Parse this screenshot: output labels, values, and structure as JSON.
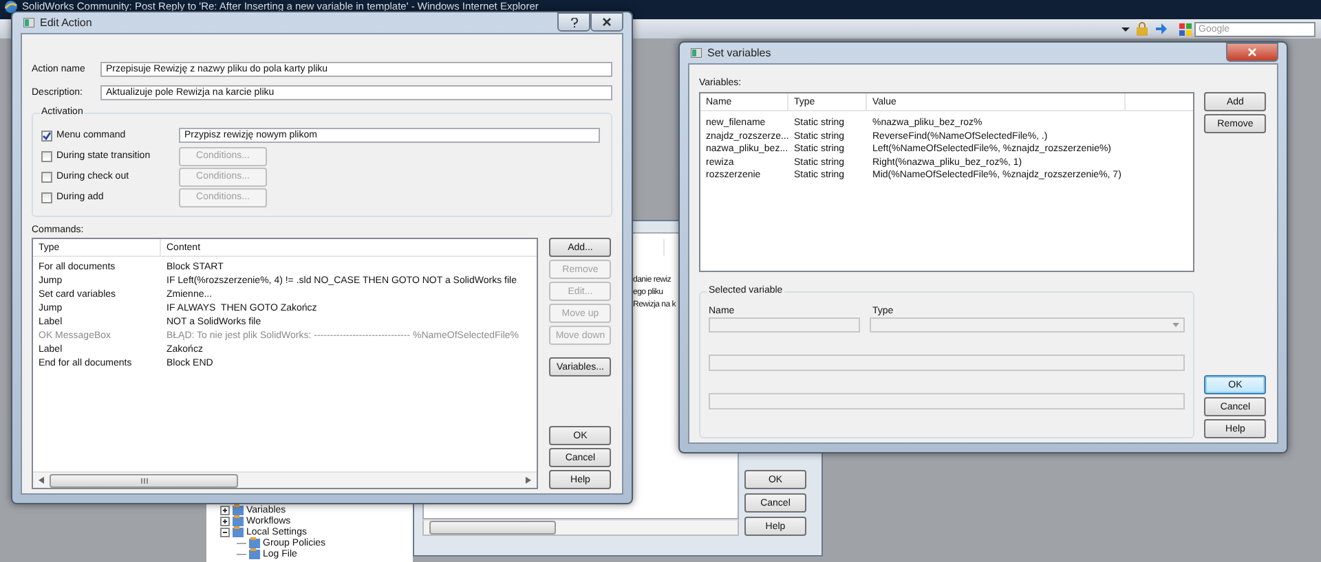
{
  "browser": {
    "title": "SolidWorks Community: Post Reply to 'Re: After Inserting a new variable in template' - Windows Internet Explorer",
    "search_placeholder": "Google"
  },
  "background_window": {
    "texts": [
      "danie rewiz",
      "ego pliku",
      "Rewizja na k"
    ],
    "buttons": [
      "OK",
      "Cancel",
      "Help"
    ]
  },
  "tree": [
    {
      "label": "Variables",
      "expanded": false
    },
    {
      "label": "Workflows",
      "expanded": false
    },
    {
      "label": "Local Settings",
      "expanded": true,
      "children": [
        {
          "label": "Group Policies"
        },
        {
          "label": "Log File"
        }
      ]
    }
  ],
  "edit_action": {
    "title": "Edit Action",
    "fields": [
      {
        "label": "Action name",
        "value": "Przepisuje Rewizję z nazwy pliku do pola karty pliku"
      },
      {
        "label": "Description:",
        "value": "Aktualizuje pole Rewizja na karcie pliku"
      }
    ],
    "activation": {
      "title": "Activation",
      "rows": [
        {
          "kind": "field",
          "label": "Menu command",
          "checked": true,
          "value": "Przypisz rewizję nowym plikom"
        },
        {
          "kind": "button",
          "label": "During state transition",
          "checked": false,
          "button": "Conditions...",
          "disabled": true
        },
        {
          "kind": "button",
          "label": "During check out",
          "checked": false,
          "button": "Conditions...",
          "disabled": true
        },
        {
          "kind": "button",
          "label": "During add",
          "checked": false,
          "button": "Conditions...",
          "disabled": true
        }
      ]
    },
    "commands": {
      "label": "Commands:",
      "columns": [
        "Type",
        "Content"
      ],
      "rows": [
        {
          "type": "For all documents",
          "content": "Block START",
          "disabled": false
        },
        {
          "type": "Jump",
          "content": "IF Left(%rozszerzenie%, 4) != .sld NO_CASE THEN GOTO NOT a SolidWorks file",
          "disabled": false
        },
        {
          "type": "Set card variables",
          "content": "Zmienne...",
          "disabled": false
        },
        {
          "type": "Jump",
          "content": "IF ALWAYS  THEN GOTO Zakończ",
          "disabled": false
        },
        {
          "type": "Label",
          "content": "NOT a SolidWorks file",
          "disabled": false
        },
        {
          "type": "OK MessageBox",
          "content": "BŁĄD: To nie jest plik SolidWorks: ------------------------------ %NameOfSelectedFile%",
          "disabled": true
        },
        {
          "type": "Label",
          "content": "Zakończ",
          "disabled": false
        },
        {
          "type": "End for all documents",
          "content": "Block END",
          "disabled": false
        }
      ]
    },
    "side_buttons": [
      {
        "label": "Add...",
        "disabled": false
      },
      {
        "label": "Remove",
        "disabled": true
      },
      {
        "label": "Edit...",
        "disabled": true
      },
      {
        "label": "Move up",
        "disabled": true
      },
      {
        "label": "Move down",
        "disabled": true
      }
    ],
    "variables_button": "Variables...",
    "footer_buttons": [
      "OK",
      "Cancel",
      "Help"
    ]
  },
  "set_variables": {
    "title": "Set variables",
    "label": "Variables:",
    "columns": [
      "Name",
      "Type",
      "Value"
    ],
    "rows": [
      {
        "name": "new_filename",
        "type": "Static string",
        "value": "%nazwa_pliku_bez_roz%"
      },
      {
        "name": "znajdz_rozszerze...",
        "type": "Static string",
        "value": "ReverseFind(%NameOfSelectedFile%, .)"
      },
      {
        "name": "nazwa_pliku_bez...",
        "type": "Static string",
        "value": "Left(%NameOfSelectedFile%, %znajdz_rozszerzenie%)"
      },
      {
        "name": "rewiza",
        "type": "Static string",
        "value": "Right(%nazwa_pliku_bez_roz%, 1)"
      },
      {
        "name": "rozszerzenie",
        "type": "Static string",
        "value": "Mid(%NameOfSelectedFile%, %znajdz_rozszerzenie%, 7)"
      }
    ],
    "top_buttons": [
      "Add",
      "Remove"
    ],
    "selected": {
      "title": "Selected variable",
      "name_label": "Name",
      "type_label": "Type",
      "disabled": true
    },
    "footer_buttons": [
      {
        "label": "OK",
        "default": true
      },
      {
        "label": "Cancel",
        "default": false
      },
      {
        "label": "Help",
        "default": false
      }
    ]
  }
}
